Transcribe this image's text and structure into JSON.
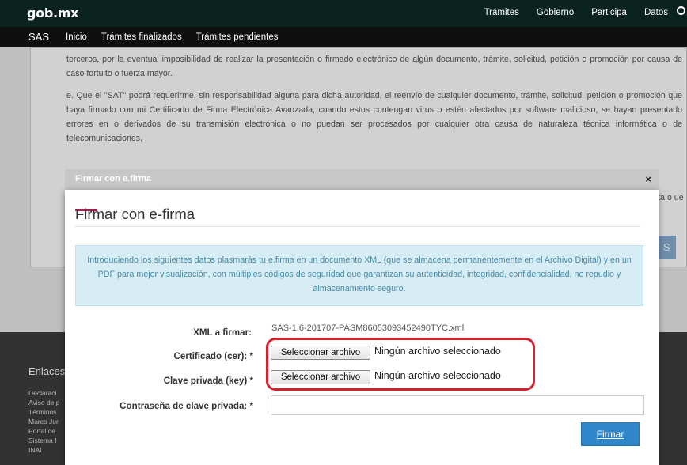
{
  "header": {
    "logo": "gob.mx",
    "nav": [
      "Trámites",
      "Gobierno",
      "Participa",
      "Datos"
    ]
  },
  "subheader": {
    "brand": "SAS",
    "nav": [
      "Inicio",
      "Trámites finalizados",
      "Trámites pendientes"
    ]
  },
  "background": {
    "para1": "terceros, por la eventual imposibilidad de realizar la presentación o firmado electrónico de algún documento, trámite, solicitud, petición o promoción por causa de caso fortuito o fuerza mayor.",
    "para2": "e. Que el \"SAT\" podrá requerirme, sin responsabilidad alguna para dicha autoridad, el reenvío de cualquier documento, trámite, solicitud, petición o promoción que haya firmado con mi Certificado de Firma Electrónica Avanzada, cuando estos contengan virus o estén afectados por software malicioso, se hayan presentado errores en o derivados de su transmisión electrónica o no puedan ser procesados por cualquier otra causa de naturaleza técnica informática o de telecomunicaciones.",
    "partial": "ecta o ue se",
    "partial_button": "S"
  },
  "footer": {
    "title": "Enlaces",
    "links": [
      "Declaraci",
      "Aviso de p",
      "Términos",
      "Marco Jur",
      "Portal de",
      "Sistema I",
      "INAI"
    ]
  },
  "modal": {
    "header_title": "Firmar con e.firma",
    "close": "×",
    "title": "Firmar con e-firma",
    "info": "Introduciendo los siguientes datos plasmarás tu e.firma en un documento XML (que se almacena permanentemente en el Archivo Digital) y en un PDF para mejor visualización, con múltiples códigos de seguridad que garantizan su autenticidad, integridad, confidencialidad, no repudio y almacenamiento seguro.",
    "xml_label": "XML a firmar:",
    "xml_value": "SAS-1.6-201707-PASM86053093452490TYC.xml",
    "cert_label": "Certificado (cer): *",
    "key_label": "Clave privada (key) *",
    "password_label": "Contraseña de clave privada: *",
    "password_value": "",
    "file_button": "Seleccionar archivo",
    "no_file": "Ningún archivo seleccionado",
    "submit": "Firmar"
  },
  "colors": {
    "header_bg": "#0b231e",
    "accent_red": "#9d2449",
    "highlight_red": "#d4202b",
    "button_blue": "#2f86c8",
    "info_bg": "#d7edf5"
  }
}
